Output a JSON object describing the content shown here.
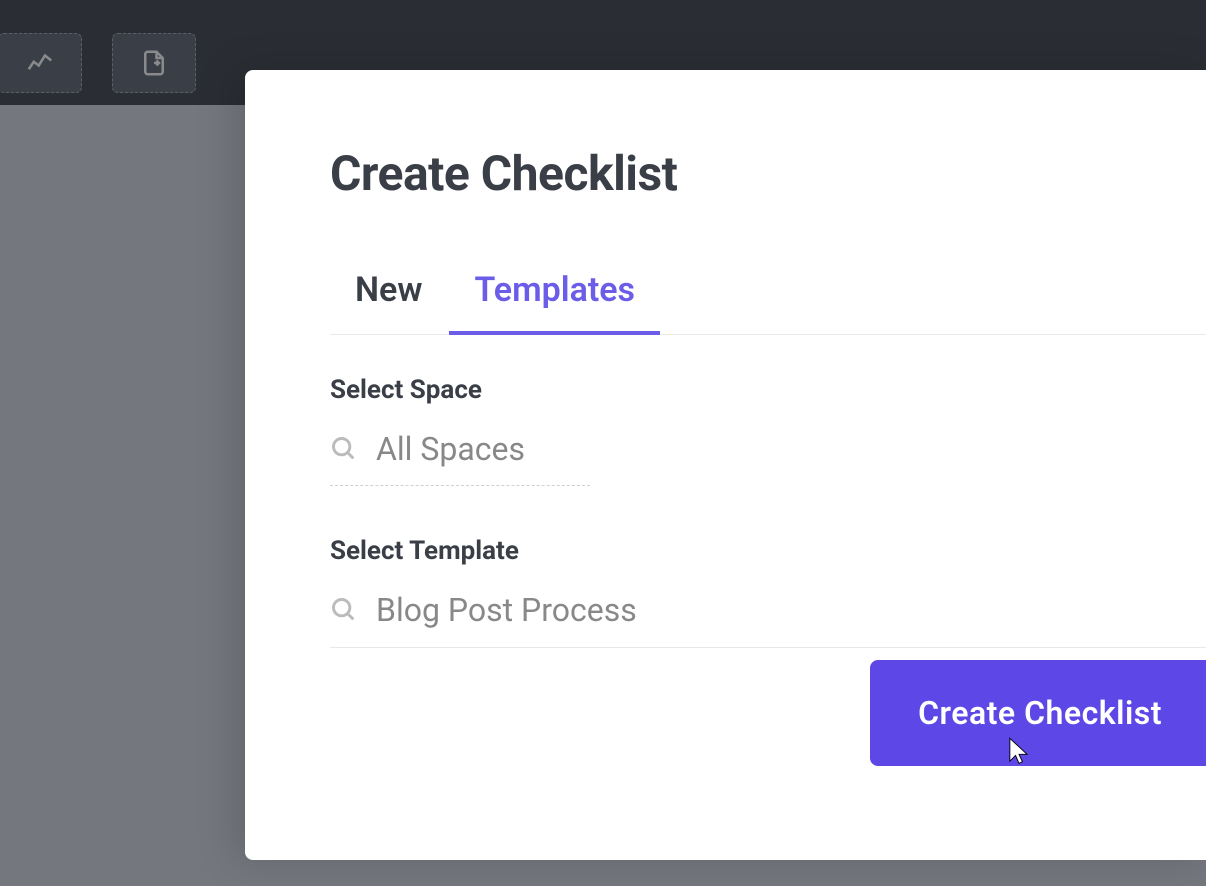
{
  "modal": {
    "title": "Create Checklist",
    "tabs": {
      "new": "New",
      "templates": "Templates"
    },
    "active_tab": "templates",
    "fields": {
      "space": {
        "label": "Select Space",
        "value": "All Spaces"
      },
      "template": {
        "label": "Select Template",
        "value": "Blog Post Process"
      }
    },
    "submit_button": "Create Checklist"
  },
  "colors": {
    "accent": "#5d47e6",
    "accent_light": "#6c5de8",
    "text_dark": "#3a3e46",
    "text_muted": "#a8a8a8",
    "toolbar_bg": "#2a2e34"
  }
}
